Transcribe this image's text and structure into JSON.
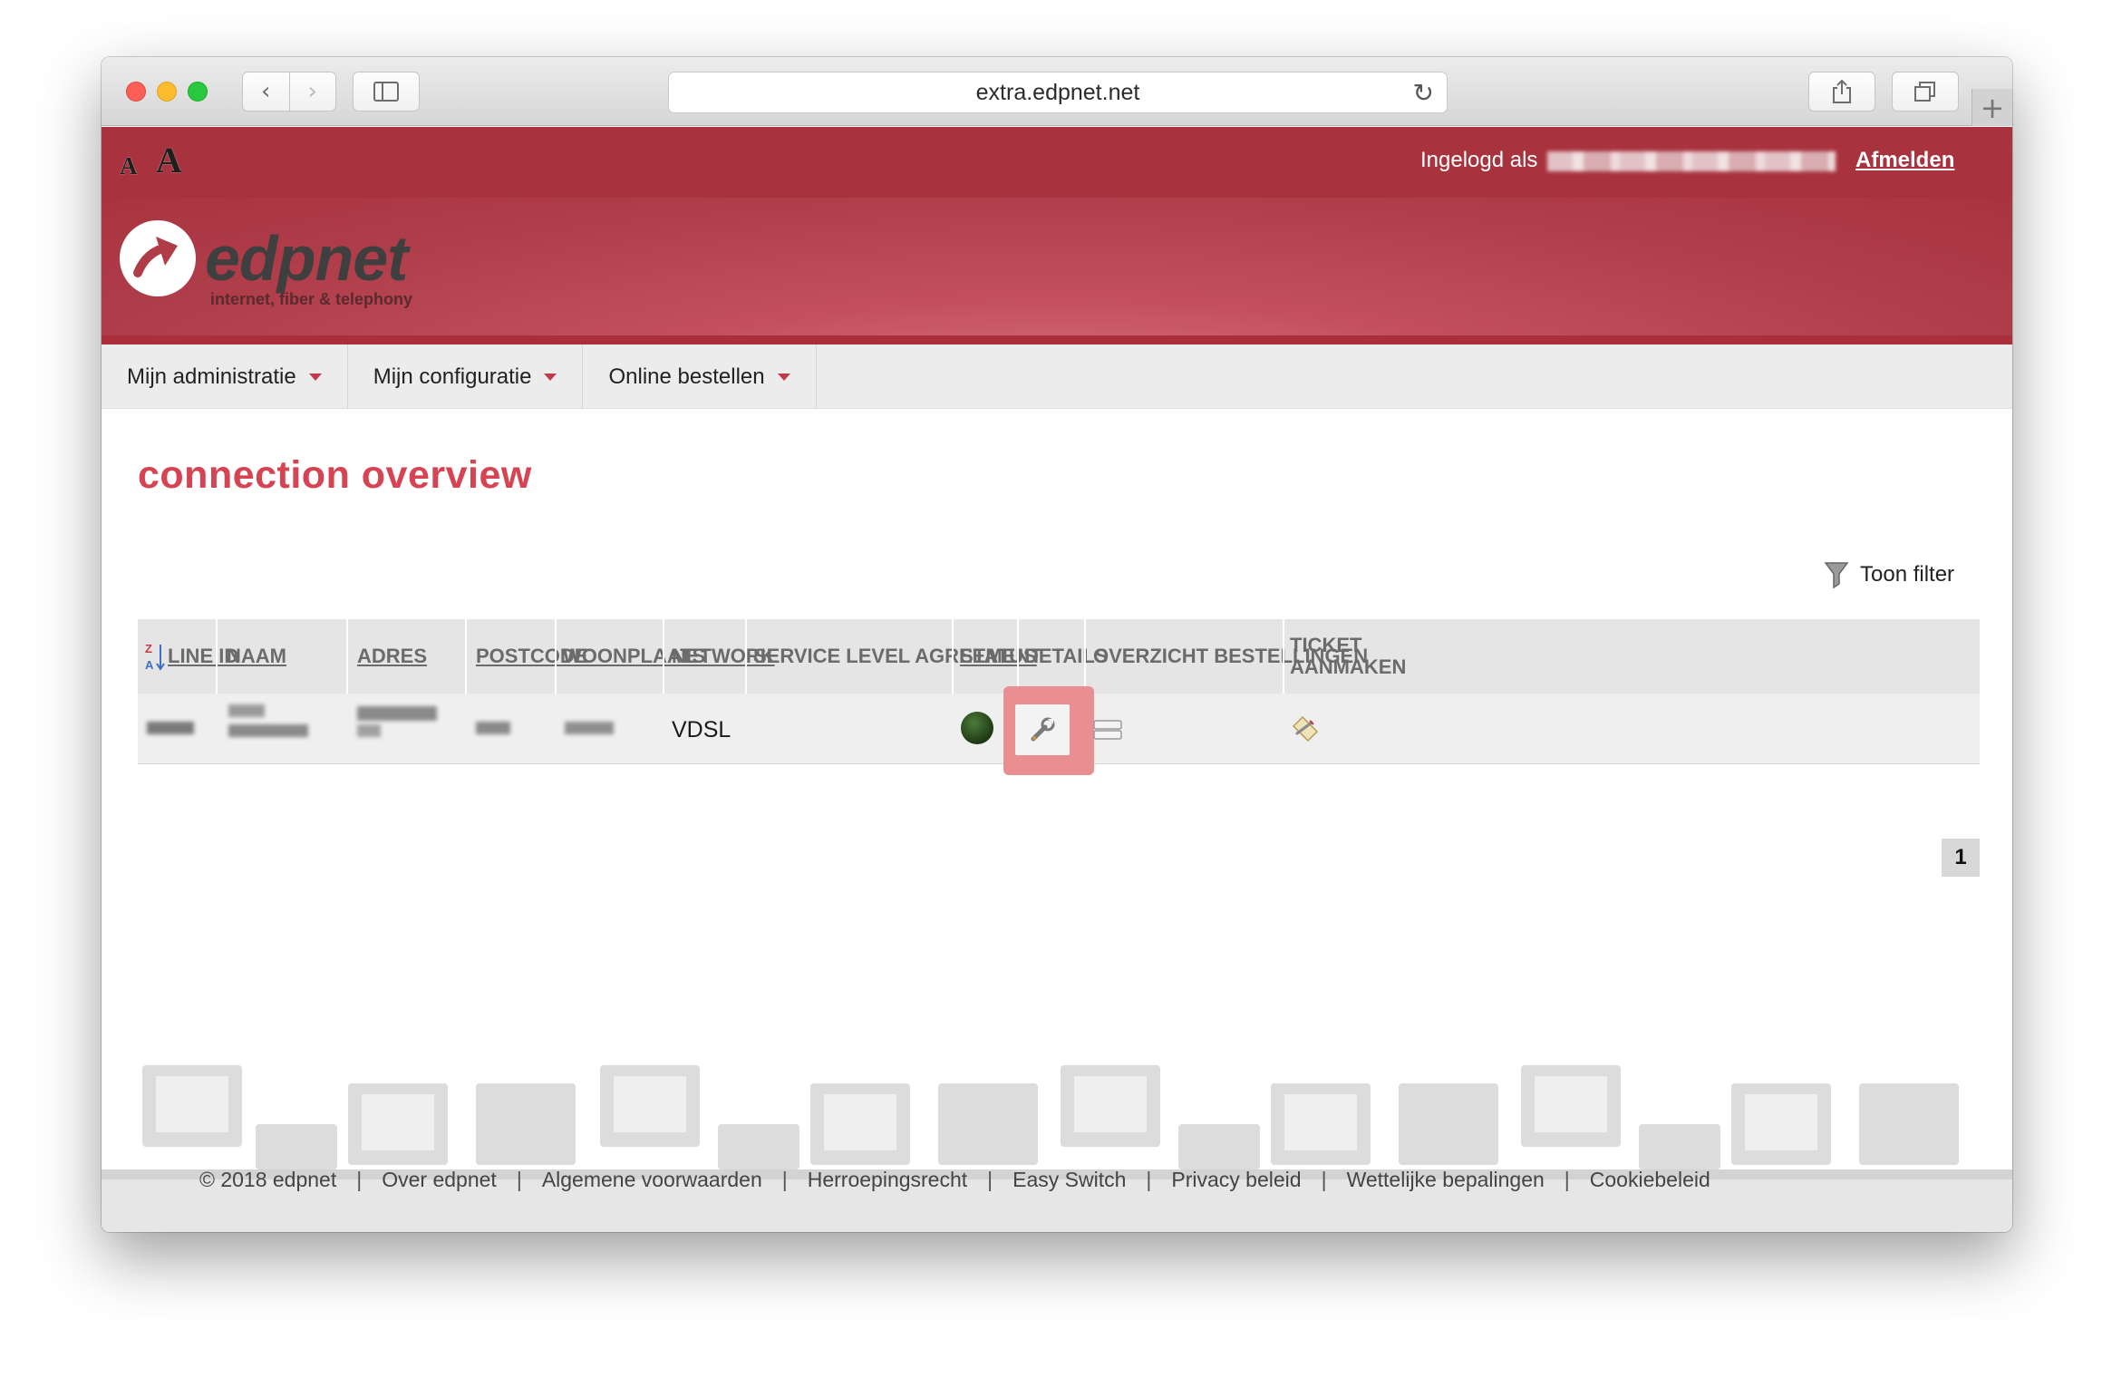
{
  "browser": {
    "url": "extra.edpnet.net",
    "back_icon": "‹",
    "forward_icon": "›",
    "newtab_icon": "+"
  },
  "topbar": {
    "font_small_label": "A",
    "font_large_label": "A",
    "login_label": "Ingelogd als",
    "logout_label": "Afmelden"
  },
  "brand": {
    "name": "edpnet",
    "tagline": "internet, fiber & telephony"
  },
  "menu": {
    "items": [
      {
        "label": "Mijn administratie"
      },
      {
        "label": "Mijn configuratie"
      },
      {
        "label": "Online bestellen"
      }
    ]
  },
  "page": {
    "title": "connection overview",
    "filter_label": "Toon filter"
  },
  "table": {
    "columns": [
      {
        "label": "LINE ID"
      },
      {
        "label": "NAAM"
      },
      {
        "label": "ADRES"
      },
      {
        "label": "POSTCODE"
      },
      {
        "label": "WOONPLAATS"
      },
      {
        "label": "NETWORK"
      },
      {
        "label": "SERVICE LEVEL AGREEMENT"
      },
      {
        "label": "STATUS"
      },
      {
        "label": "DETAILS"
      },
      {
        "label": "OVERZICHT BESTELLINGEN"
      },
      {
        "label": "TICKET AANMAKEN"
      }
    ],
    "rows": [
      {
        "network": "VDSL",
        "status_color": "#2e5a22"
      }
    ],
    "sort_icon": "sort-za-icon"
  },
  "pagination": {
    "current_page": "1"
  },
  "footer": {
    "links": [
      "© 2018 edpnet",
      "Over edpnet",
      "Algemene voorwaarden",
      "Herroepingsrecht",
      "Easy Switch",
      "Privacy beleid",
      "Wettelijke bepalingen",
      "Cookiebeleid"
    ],
    "separator": "|"
  },
  "colors": {
    "brand_red": "#a8323e",
    "heading_red": "#d64352",
    "highlight": "#e98f92"
  }
}
